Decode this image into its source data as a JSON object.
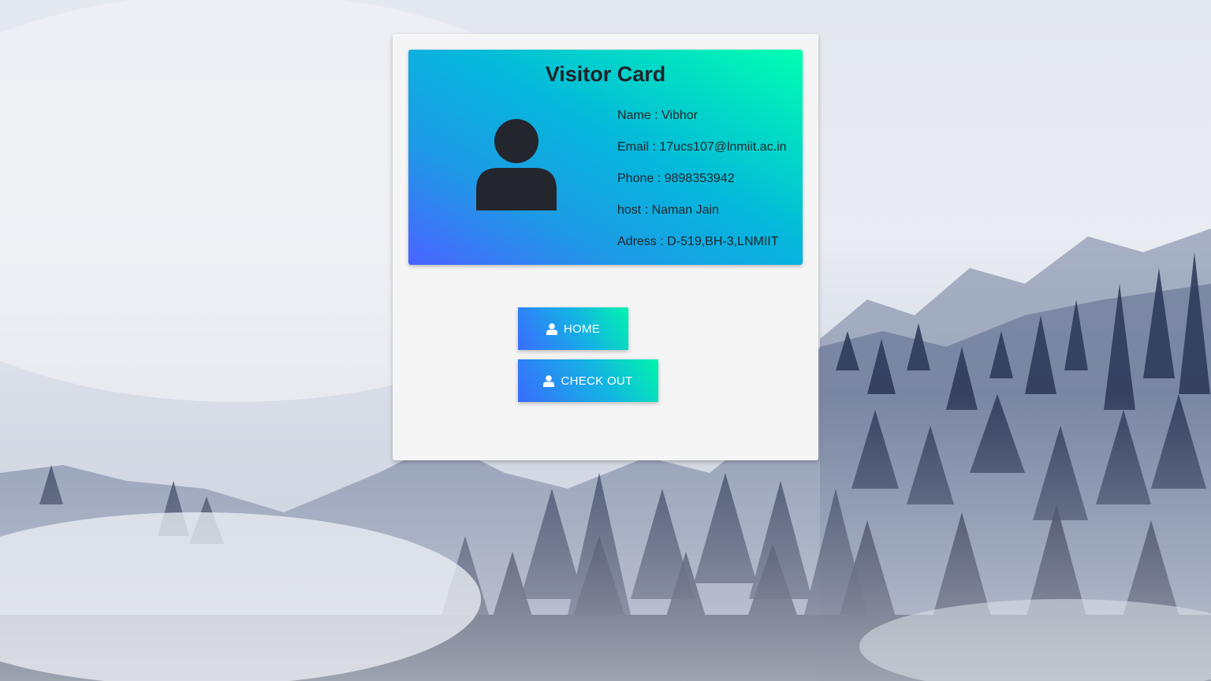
{
  "card": {
    "title": "Visitor Card",
    "avatar_icon": "user-icon",
    "fields": {
      "name": "Name : Vibhor",
      "email": "Email : 17ucs107@lnmiit.ac.in",
      "phone": "Phone : 9898353942",
      "host": "host : Naman Jain",
      "address": "Adress : D-519,BH-3,LNMIIT"
    }
  },
  "buttons": {
    "home": {
      "label": "HOME",
      "icon": "user-icon"
    },
    "checkout": {
      "label": "CHECK OUT",
      "icon": "user-icon"
    }
  },
  "colors": {
    "card_gradient_start": "#4a63ff",
    "card_gradient_end": "#00ffb0",
    "button_gradient_start": "#3a6cff",
    "button_gradient_end": "#00f5ad"
  }
}
